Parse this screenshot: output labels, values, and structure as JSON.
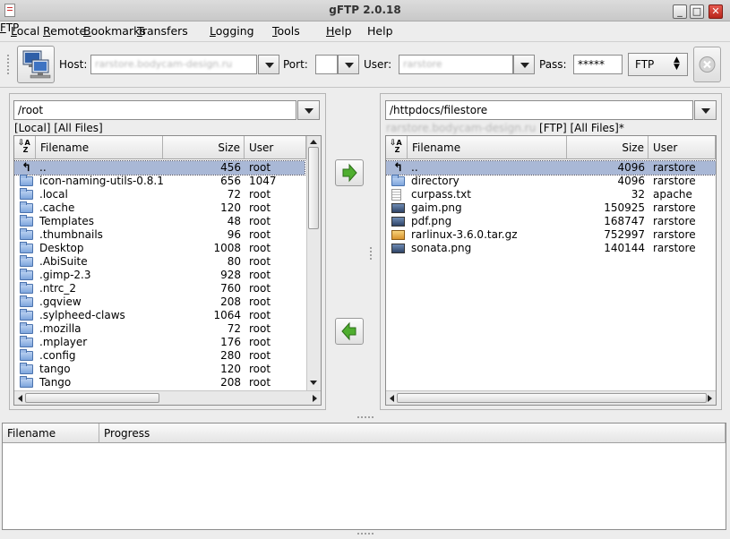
{
  "window": {
    "title": "gFTP 2.0.18",
    "controls": {
      "minimize": "_",
      "maximize": "□",
      "close": "✕"
    }
  },
  "menu": [
    {
      "label": "FTP",
      "mnemonic": "F"
    },
    {
      "label": "Local",
      "mnemonic": "L"
    },
    {
      "label": "Remote",
      "mnemonic": "R"
    },
    {
      "label": "Bookmarks",
      "mnemonic": "B"
    },
    {
      "label": "Transfers",
      "mnemonic": "T"
    },
    {
      "label": "Logging",
      "mnemonic": "L"
    },
    {
      "label": "Tools",
      "mnemonic": "T"
    },
    {
      "label": "Help",
      "mnemonic": "H"
    }
  ],
  "toolbar": {
    "host_label": "Host:",
    "host_value": "rarstore.bodycam-design.ru",
    "port_label": "Port:",
    "port_value": "",
    "user_label": "User:",
    "user_value": "rarstore",
    "pass_label": "Pass:",
    "pass_value": "*****",
    "protocol": "FTP"
  },
  "local": {
    "path": "/root",
    "status": "[Local] [All Files]",
    "columns": {
      "filename": "Filename",
      "size": "Size",
      "user": "User"
    },
    "files": [
      {
        "icon": "up-arrow-icon",
        "name": "..",
        "size": "456",
        "user": "root",
        "selected": true
      },
      {
        "icon": "folder-icon",
        "name": "icon-naming-utils-0.8.1",
        "size": "656",
        "user": "1047"
      },
      {
        "icon": "folder-icon",
        "name": ".local",
        "size": "72",
        "user": "root"
      },
      {
        "icon": "folder-icon",
        "name": ".cache",
        "size": "120",
        "user": "root"
      },
      {
        "icon": "folder-icon",
        "name": "Templates",
        "size": "48",
        "user": "root"
      },
      {
        "icon": "folder-icon",
        "name": ".thumbnails",
        "size": "96",
        "user": "root"
      },
      {
        "icon": "folder-icon",
        "name": "Desktop",
        "size": "1008",
        "user": "root"
      },
      {
        "icon": "folder-icon",
        "name": ".AbiSuite",
        "size": "80",
        "user": "root"
      },
      {
        "icon": "folder-icon",
        "name": ".gimp-2.3",
        "size": "928",
        "user": "root"
      },
      {
        "icon": "folder-icon",
        "name": ".ntrc_2",
        "size": "760",
        "user": "root"
      },
      {
        "icon": "folder-icon",
        "name": ".gqview",
        "size": "208",
        "user": "root"
      },
      {
        "icon": "folder-icon",
        "name": ".sylpheed-claws",
        "size": "1064",
        "user": "root"
      },
      {
        "icon": "folder-icon",
        "name": ".mozilla",
        "size": "72",
        "user": "root"
      },
      {
        "icon": "folder-icon",
        "name": ".mplayer",
        "size": "176",
        "user": "root"
      },
      {
        "icon": "folder-icon",
        "name": ".config",
        "size": "280",
        "user": "root"
      },
      {
        "icon": "folder-icon",
        "name": "tango",
        "size": "120",
        "user": "root"
      },
      {
        "icon": "folder-icon",
        "name": "Tango",
        "size": "208",
        "user": "root"
      }
    ]
  },
  "remote": {
    "path": "/httpdocs/filestore",
    "host_prefix": "rarstore.bodycam-design.ru",
    "status": "[FTP] [All Files]*",
    "columns": {
      "filename": "Filename",
      "size": "Size",
      "user": "User"
    },
    "files": [
      {
        "icon": "up-arrow-icon",
        "name": "..",
        "size": "4096",
        "user": "rarstore",
        "selected": true
      },
      {
        "icon": "folder-icon",
        "name": "directory",
        "size": "4096",
        "user": "rarstore"
      },
      {
        "icon": "text-file-icon",
        "name": "curpass.txt",
        "size": "32",
        "user": "apache"
      },
      {
        "icon": "image-file-icon",
        "name": "gaim.png",
        "size": "150925",
        "user": "rarstore"
      },
      {
        "icon": "image-file-icon",
        "name": "pdf.png",
        "size": "168747",
        "user": "rarstore"
      },
      {
        "icon": "archive-file-icon",
        "name": "rarlinux-3.6.0.tar.gz",
        "size": "752997",
        "user": "rarstore"
      },
      {
        "icon": "image-file-icon",
        "name": "sonata.png",
        "size": "140144",
        "user": "rarstore"
      }
    ]
  },
  "transfers": {
    "columns": {
      "filename": "Filename",
      "progress": "Progress"
    }
  },
  "colors": {
    "selection": "#a9b8d6",
    "arrow_green": "#4fae2f"
  }
}
